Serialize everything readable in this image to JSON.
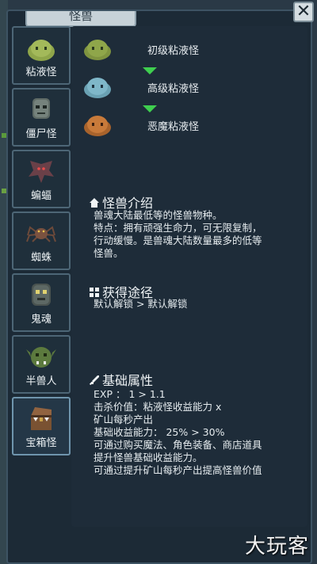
{
  "window": {
    "title": "怪兽",
    "close_label": "✕"
  },
  "sidebar": {
    "items": [
      {
        "label": "粘液怪",
        "icon": "slime-icon",
        "active": false
      },
      {
        "label": "僵尸怪",
        "icon": "zombie-icon",
        "active": false
      },
      {
        "label": "蝙蝠",
        "icon": "bat-icon",
        "active": false
      },
      {
        "label": "蜘蛛",
        "icon": "spider-icon",
        "active": false
      },
      {
        "label": "鬼魂",
        "icon": "ghost-icon",
        "active": false
      },
      {
        "label": "半兽人",
        "icon": "orc-icon",
        "active": false
      },
      {
        "label": "宝箱怪",
        "icon": "mimic-icon",
        "active": true
      }
    ]
  },
  "evolution": {
    "stages": [
      {
        "name": "初级粘液怪",
        "color": "#8fa64a"
      },
      {
        "name": "高级粘液怪",
        "color": "#7fb7c9"
      },
      {
        "name": "恶魔粘液怪",
        "color": "#c87a3a"
      }
    ],
    "arrow_color": "#3fcf4f"
  },
  "intro": {
    "heading": "怪兽介绍",
    "lines": [
      "兽魂大陆最低等的怪兽物种。",
      "特点：拥有顽强生命力，可无限复制，",
      "行动缓慢。是兽魂大陆数量最多的低等",
      "怪兽。"
    ]
  },
  "obtain": {
    "heading": "获得途径",
    "lines": [
      "默认解锁 > 默认解锁"
    ]
  },
  "stats": {
    "heading": "基础属性",
    "lines": [
      "EXP ：  1 > 1.1",
      "击杀价值：粘液怪收益能力 x",
      "矿山每秒产出",
      "基础收益能力：  25% > 30%",
      "可通过购买魔法、角色装备、商店道具",
      "提升怪兽基础收益能力。",
      "可通过提升矿山每秒产出提高怪兽价值"
    ]
  },
  "watermark": "大玩客"
}
